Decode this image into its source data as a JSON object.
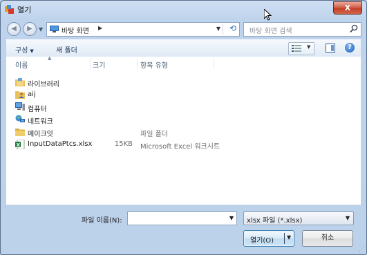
{
  "window": {
    "title": "열기",
    "close_label": "X"
  },
  "nav": {
    "address": "바탕 화면",
    "search_placeholder": "바탕 화면 검색"
  },
  "toolbar": {
    "organize": "구성",
    "new_folder": "새 폴더"
  },
  "columns": {
    "name": "이름",
    "size": "크기",
    "type": "항목 유형"
  },
  "items": [
    {
      "name": "라이브러리",
      "size": "",
      "type": "",
      "icon": "library-icon"
    },
    {
      "name": "aij",
      "size": "",
      "type": "",
      "icon": "user-folder-icon"
    },
    {
      "name": "컴퓨터",
      "size": "",
      "type": "",
      "icon": "computer-icon"
    },
    {
      "name": "네트워크",
      "size": "",
      "type": "",
      "icon": "network-icon"
    },
    {
      "name": "메이크잇",
      "size": "",
      "type": "파일 폴더",
      "icon": "folder-icon"
    },
    {
      "name": "InputDataPtcs.xlsx",
      "size": "15KB",
      "type": "Microsoft Excel 워크시트",
      "icon": "excel-file-icon"
    }
  ],
  "bottom": {
    "filename_label": "파일 이름(N):",
    "filename_value": "",
    "filter_value": "xlsx 파일 (*.xlsx)",
    "open_label": "열기(O)",
    "cancel_label": "취소"
  },
  "colors": {
    "accent": "#2d6db6",
    "titlebar": "#bed3ec",
    "close": "#c23d25"
  }
}
